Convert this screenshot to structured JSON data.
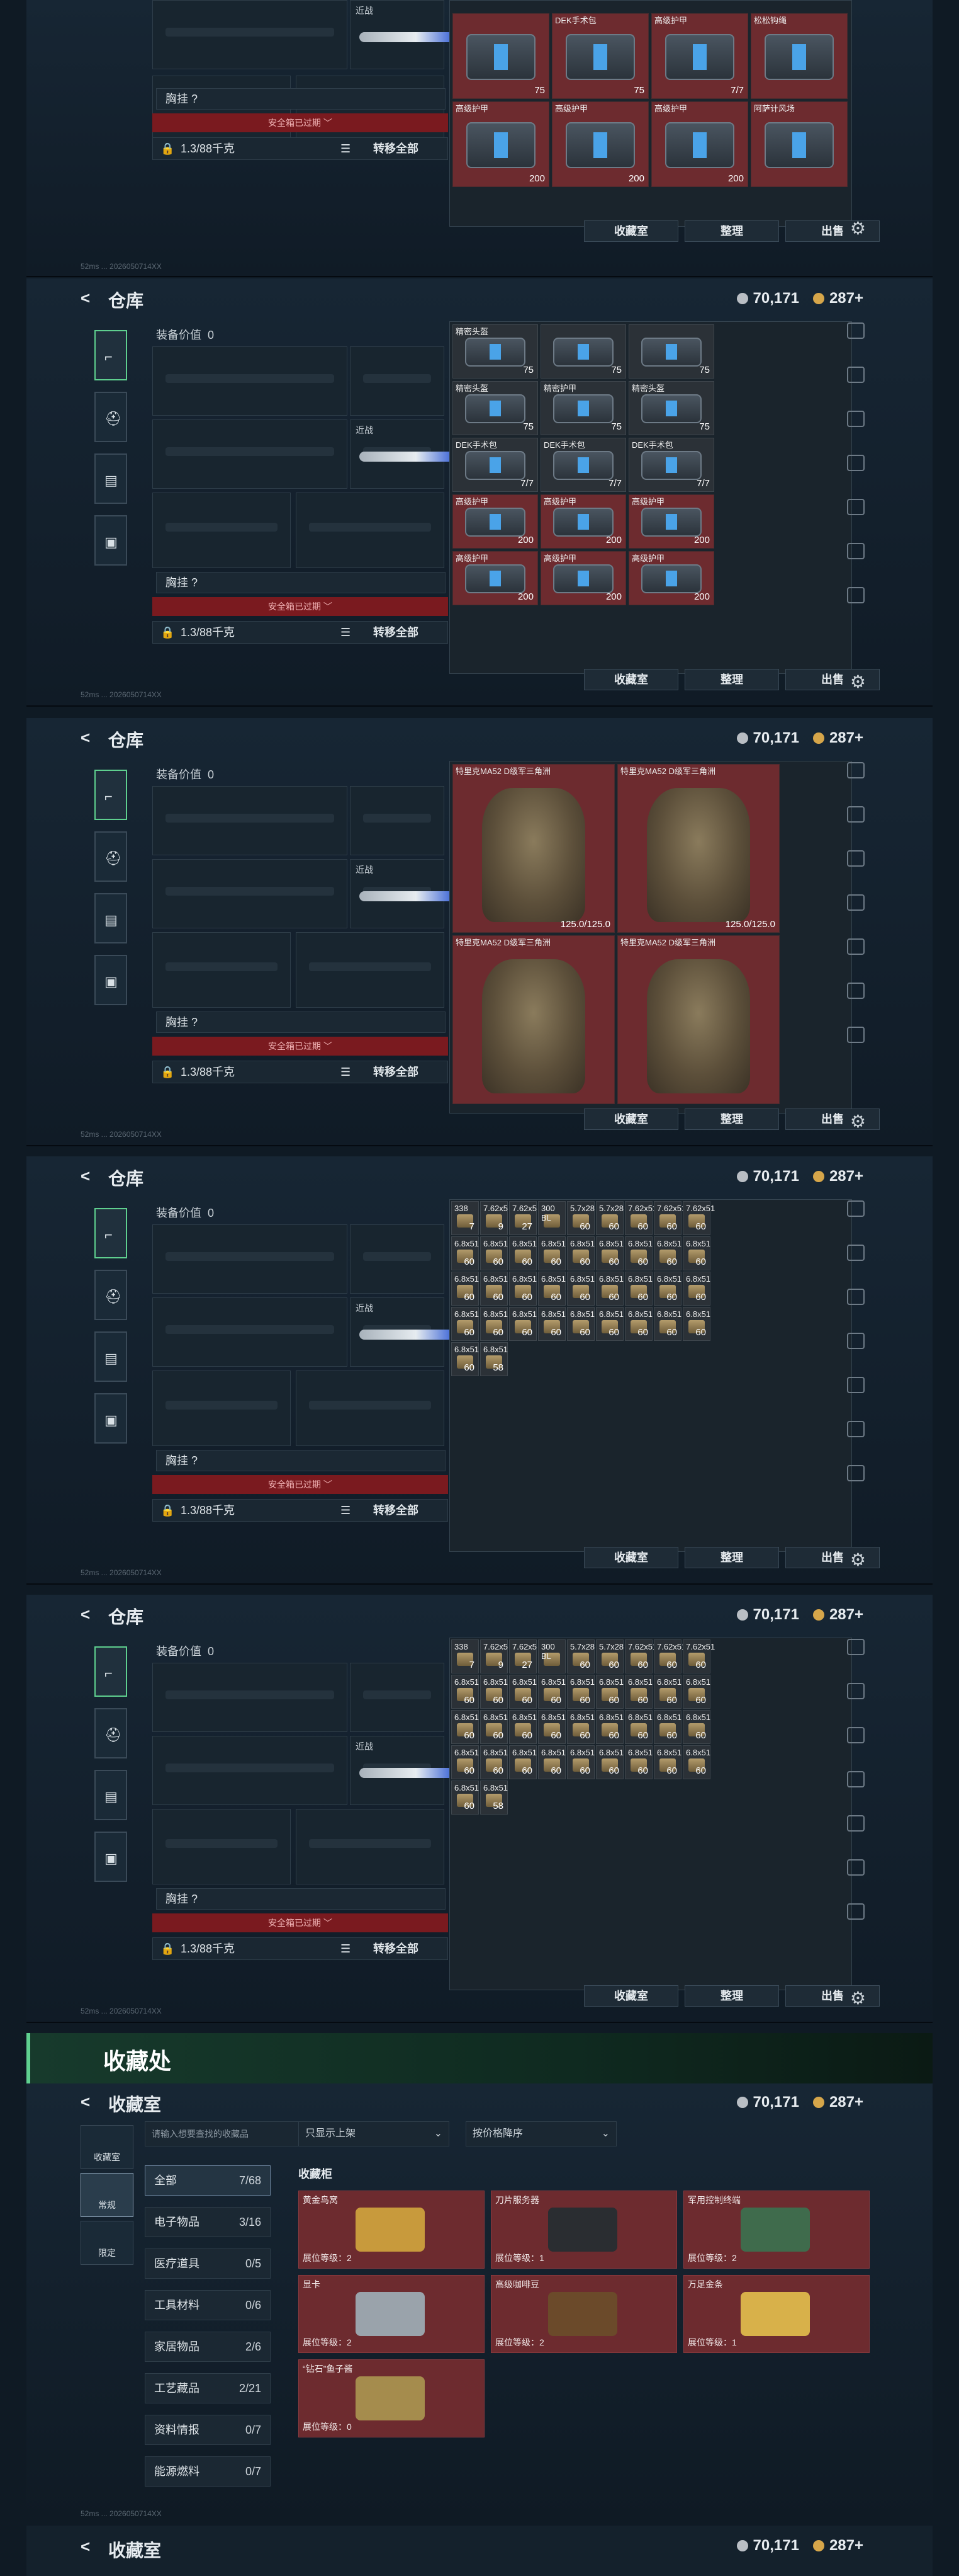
{
  "warehouse": {
    "title": "仓库",
    "back": "<",
    "silver": "70,171",
    "gold": "287+",
    "equip_value_label": "装备价值",
    "equip_value": "0",
    "chest_label": "胸挂 ?",
    "expired_text": "安全箱已过期 ﹀",
    "weight": "1.3/88千克",
    "transfer_all": "转移全部",
    "slot_label": "近战",
    "btn_collection": "收藏室",
    "btn_sort": "整理",
    "btn_sell": "出售",
    "footer": "52ms  ...  2026050714XX"
  },
  "grid_items_a": [
    {
      "name": "",
      "count": "75"
    },
    {
      "name": "DEK手术包",
      "count": "75"
    },
    {
      "name": "高级护甲",
      "count": "7/7"
    },
    {
      "name": "松松钩绳",
      "count": ""
    },
    {
      "name": "高级护甲",
      "count": "200"
    },
    {
      "name": "高级护甲",
      "count": "200"
    },
    {
      "name": "高级护甲",
      "count": "200"
    },
    {
      "name": "阿萨计风场",
      "count": ""
    }
  ],
  "grid_items_b": [
    {
      "name": "精密头盔",
      "count": "75"
    },
    {
      "name": "",
      "count": "75"
    },
    {
      "name": "",
      "count": "75"
    },
    {
      "name": "精密头盔",
      "count": "75"
    },
    {
      "name": "精密护甲",
      "count": "75"
    },
    {
      "name": "精密头盔",
      "count": "75"
    },
    {
      "name": "DEK手术包",
      "count": "7/7"
    },
    {
      "name": "DEK手术包",
      "count": "7/7"
    },
    {
      "name": "DEK手术包",
      "count": "7/7"
    },
    {
      "name": "高级护甲",
      "count": "200"
    },
    {
      "name": "高级护甲",
      "count": "200"
    },
    {
      "name": "高级护甲",
      "count": "200"
    },
    {
      "name": "高级护甲",
      "count": "200"
    },
    {
      "name": "高级护甲",
      "count": "200"
    },
    {
      "name": "高级护甲",
      "count": "200"
    }
  ],
  "armor_items": [
    {
      "name": "特里克MA52 D级军三角洲",
      "durability": "125.0/125.0"
    },
    {
      "name": "特里克MA52 D级军三角洲",
      "durability": "125.0/125.0"
    },
    {
      "name": "特里克MA52 D级军三角洲",
      "durability": ""
    },
    {
      "name": "特里克MA52 D级军三角洲",
      "durability": ""
    }
  ],
  "ammo_header": [
    {
      "name": "338",
      "count": "7"
    },
    {
      "name": "7.62x5",
      "count": "9"
    },
    {
      "name": "7.62x5",
      "count": "27"
    },
    {
      "name": "300 BL",
      "count": ""
    },
    {
      "name": "5.7x28",
      "count": "60"
    },
    {
      "name": "5.7x28",
      "count": "60"
    },
    {
      "name": "7.62x51",
      "count": "60"
    },
    {
      "name": "7.62x51",
      "count": "60"
    },
    {
      "name": "7.62x51",
      "count": "60"
    }
  ],
  "ammo_cell": {
    "name": "6.8x51",
    "count": "60"
  },
  "ammo_last": {
    "name": "6.8x51",
    "count": "58"
  },
  "collection": {
    "banner": "收藏处",
    "title": "收藏室",
    "search_placeholder": "请输入想要查找的收藏品",
    "filter1": "只显示上架",
    "filter2": "按价格降序",
    "section": "收藏柜",
    "left_tabs": [
      "收藏室",
      "常规",
      "限定"
    ],
    "categories": [
      {
        "label": "全部",
        "value": "7/68"
      },
      {
        "label": "电子物品",
        "value": "3/16"
      },
      {
        "label": "医疗道具",
        "value": "0/5"
      },
      {
        "label": "工具材料",
        "value": "0/6"
      },
      {
        "label": "家居物品",
        "value": "2/6"
      },
      {
        "label": "工艺藏品",
        "value": "2/21"
      },
      {
        "label": "资料情报",
        "value": "0/7"
      },
      {
        "label": "能源燃料",
        "value": "0/7"
      }
    ],
    "cards": [
      {
        "title": "黄金鸟窝",
        "level": "展位等级：2",
        "color": "#c89a3c"
      },
      {
        "title": "刀片服务器",
        "level": "展位等级：1",
        "color": "#2a2d31"
      },
      {
        "title": "军用控制终端",
        "level": "展位等级：2",
        "color": "#3f6b4c"
      },
      {
        "title": "显卡",
        "level": "展位等级：2",
        "color": "#9aa3ab"
      },
      {
        "title": "高级咖啡豆",
        "level": "展位等级：2",
        "color": "#6b4a2a"
      },
      {
        "title": "万足金条",
        "level": "展位等级：1",
        "color": "#d8b14a"
      },
      {
        "title": "“钻石”鱼子酱",
        "level": "展位等级：0",
        "color": "#a58c4d"
      }
    ]
  }
}
